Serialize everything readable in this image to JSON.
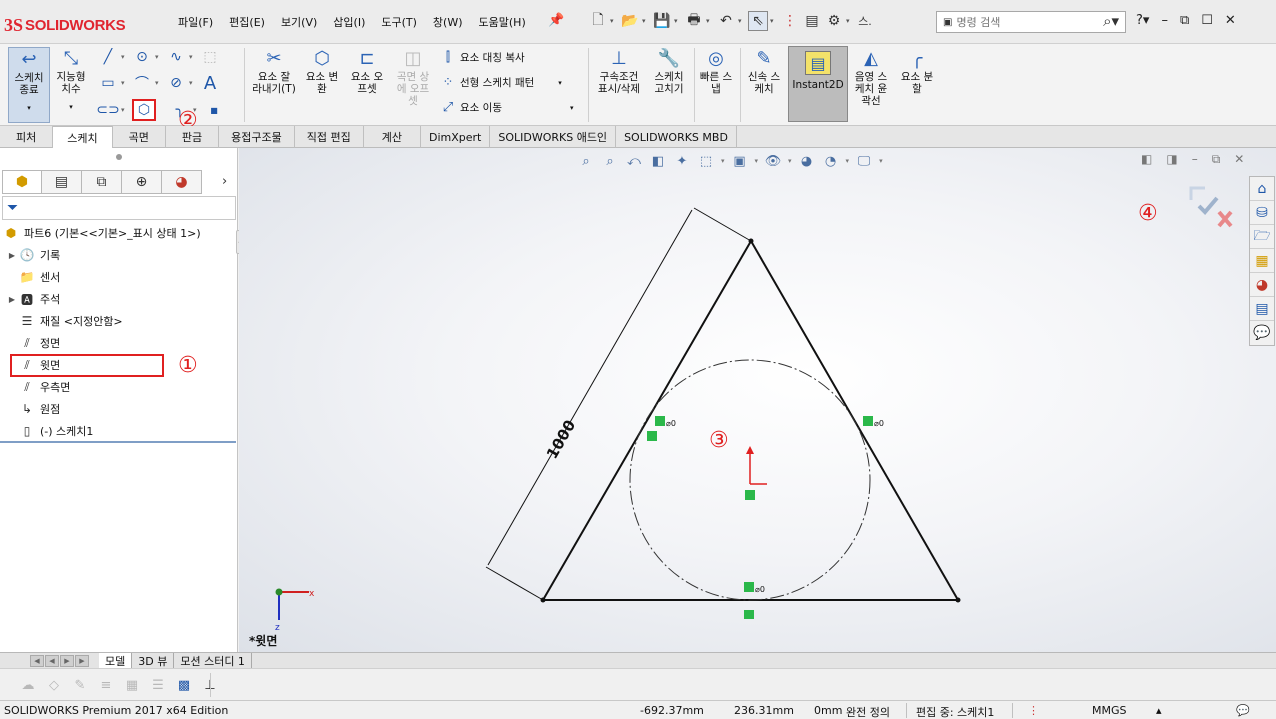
{
  "app": {
    "logo_ds": "3S",
    "logo_text": "SOLIDWORKS"
  },
  "menu": [
    "파일(F)",
    "편집(E)",
    "보기(V)",
    "삽입(I)",
    "도구(T)",
    "창(W)",
    "도움말(H)"
  ],
  "search": {
    "placeholder": "명령 검색",
    "extra_label": "스."
  },
  "ribbon": {
    "sketch_exit": "스케치\n종료",
    "smart_dim": "지능형\n치수",
    "trim": "요소 잘\n라내기(T)",
    "convert": "요소 변\n환",
    "offset": "요소 오\n프셋",
    "surface_offset": "곡면 상\n에 오프\n셋",
    "mirror": "요소 대칭 복사",
    "linear_pattern": "선형 스케치 패턴",
    "move": "요소 이동",
    "relations": "구속조건\n표시/삭제",
    "repair": "스케치\n고치기",
    "quick_snaps": "빠른 스\n냅",
    "rapid_sketch": "신속 스\n케치",
    "instant2d": "Instant2D",
    "shaded_contours": "음영 스\n케치 윤\n곽선",
    "split": "요소 분\n할"
  },
  "tabs": [
    "피처",
    "스케치",
    "곡면",
    "판금",
    "용접구조물",
    "직접 편집",
    "계산",
    "DimXpert",
    "SOLIDWORKS 애드인",
    "SOLIDWORKS MBD"
  ],
  "active_tab": "스케치",
  "tree": {
    "root": "파트6  (기본<<기본>_표시 상태 1>)",
    "items": [
      "기록",
      "센서",
      "주석",
      "재질 <지정안함>",
      "정면",
      "윗면",
      "우측면",
      "원점",
      "(-) 스케치1"
    ]
  },
  "annotations": [
    "①",
    "②",
    "③",
    "④"
  ],
  "sketch": {
    "dimension": "1000",
    "axis_x": "x",
    "axis_y": "z",
    "view_name": "*윗면"
  },
  "bottom_tabs": [
    "모델",
    "3D 뷰",
    "모션 스터디 1"
  ],
  "status": {
    "edition": "SOLIDWORKS Premium 2017 x64 Edition",
    "x": "-692.37mm",
    "y": "236.31mm",
    "z": "0mm",
    "defined": "완전 정의",
    "editing": "편집 중: 스케치1",
    "units": "MMGS"
  }
}
